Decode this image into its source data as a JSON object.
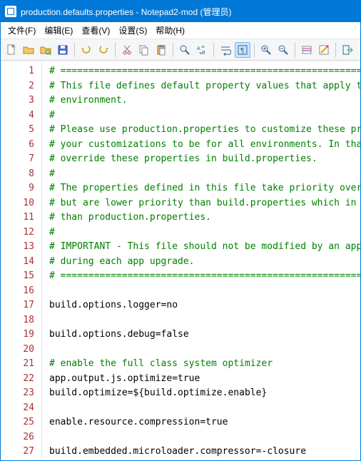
{
  "window": {
    "title": "production.defaults.properties - Notepad2-mod (管理员)"
  },
  "menu": {
    "file": "文件(F)",
    "edit": "编辑(E)",
    "view": "查看(V)",
    "settings": "设置(S)",
    "help": "帮助(H)"
  },
  "lines": [
    {
      "n": 1,
      "type": "comment",
      "text": "# ==========================================================================="
    },
    {
      "n": 2,
      "type": "comment",
      "text": "# This file defines default property values that apply to the \"p"
    },
    {
      "n": 3,
      "type": "comment",
      "text": "# environment."
    },
    {
      "n": 4,
      "type": "comment",
      "text": "#"
    },
    {
      "n": 5,
      "type": "comment",
      "text": "# Please use production.properties to customize these properti"
    },
    {
      "n": 6,
      "type": "comment",
      "text": "# your customizations to be for all environments. In that case,"
    },
    {
      "n": 7,
      "type": "comment",
      "text": "# override these properties in build.properties."
    },
    {
      "n": 8,
      "type": "comment",
      "text": "#"
    },
    {
      "n": 9,
      "type": "comment",
      "text": "# The properties defined in this file take priority over defaul"
    },
    {
      "n": 10,
      "type": "comment",
      "text": "# but are lower priority than build.properties which in turn is"
    },
    {
      "n": 11,
      "type": "comment",
      "text": "# than production.properties."
    },
    {
      "n": 12,
      "type": "comment",
      "text": "#"
    },
    {
      "n": 13,
      "type": "comment",
      "text": "# IMPORTANT - This file should not be modified by an app as it is"
    },
    {
      "n": 14,
      "type": "comment",
      "text": "# during each app upgrade."
    },
    {
      "n": 15,
      "type": "comment",
      "text": "# ==========================================================================="
    },
    {
      "n": 16,
      "type": "blank",
      "text": ""
    },
    {
      "n": 17,
      "type": "prop",
      "key": "build.options.logger",
      "val": "no"
    },
    {
      "n": 18,
      "type": "blank",
      "text": ""
    },
    {
      "n": 19,
      "type": "prop",
      "key": "build.options.debug",
      "val": "false"
    },
    {
      "n": 20,
      "type": "blank",
      "text": ""
    },
    {
      "n": 21,
      "type": "comment",
      "text": "# enable the full class system optimizer"
    },
    {
      "n": 22,
      "type": "prop",
      "key": "app.output.js.optimize",
      "val": "true"
    },
    {
      "n": 23,
      "type": "prop",
      "key": "build.optimize",
      "val": "${build.optimize.enable}"
    },
    {
      "n": 24,
      "type": "blank",
      "text": ""
    },
    {
      "n": 25,
      "type": "prop",
      "key": "enable.resource.compression",
      "val": "true"
    },
    {
      "n": 26,
      "type": "blank",
      "text": ""
    },
    {
      "n": 27,
      "type": "prop",
      "key": "build.embedded.microloader.compressor",
      "val": "-closure"
    }
  ]
}
